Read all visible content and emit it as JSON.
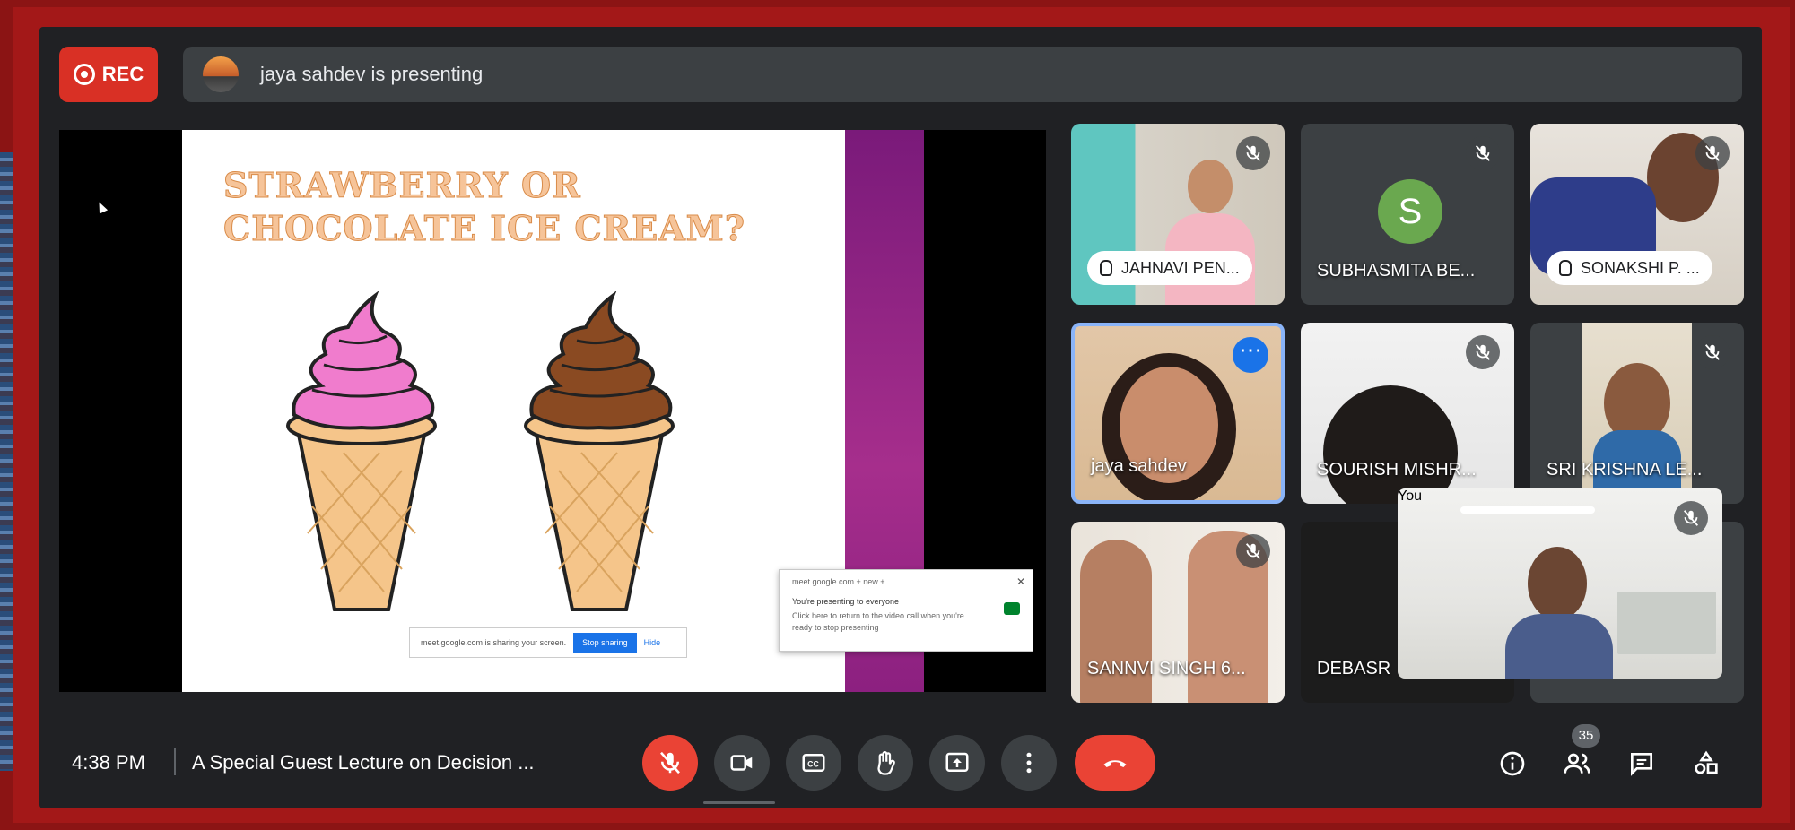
{
  "recording": {
    "label": "REC"
  },
  "presenting": {
    "text": "jaya sahdev is presenting"
  },
  "slide": {
    "title": "STRAWBERRY OR CHOCOLATE ICE CREAM?",
    "popup_line1": "meet.google.com + new +",
    "popup_line2": "You're presenting to everyone",
    "popup_line3": "Click here to return to the video call when you're ready to stop presenting",
    "share_notice": "meet.google.com is sharing your screen.",
    "stop_sharing": "Stop sharing",
    "hide": "Hide"
  },
  "participants": [
    {
      "name": "JAHNAVI PEN...",
      "hand_raised": true,
      "muted": true
    },
    {
      "name": "SUBHASMITA BE...",
      "initial": "S",
      "muted": true
    },
    {
      "name": "SONAKSHI P. ...",
      "hand_raised": true,
      "muted": true
    },
    {
      "name": "jaya sahdev",
      "active_speaker": true
    },
    {
      "name": "SOURISH MISHR...",
      "muted": true
    },
    {
      "name": "SRI KRISHNA LE...",
      "muted": true
    },
    {
      "name": "SANNVI SINGH 6...",
      "muted": true
    },
    {
      "name": "DEBASR"
    }
  ],
  "self_view": {
    "label": "You",
    "muted": true
  },
  "bottom": {
    "time": "4:38 PM",
    "meeting_title": "A Special Guest Lecture on Decision ...",
    "participant_count": "35"
  },
  "colors": {
    "bar_bg": "#202124",
    "tile_bg": "#3c4043",
    "danger": "#ea4335",
    "accent": "#8ab4f8"
  },
  "icons": [
    "record-icon",
    "mic-off-icon",
    "camera-icon",
    "captions-icon",
    "raise-hand-icon",
    "present-icon",
    "more-options-icon",
    "end-call-icon",
    "info-icon",
    "people-icon",
    "chat-icon",
    "activities-icon"
  ]
}
